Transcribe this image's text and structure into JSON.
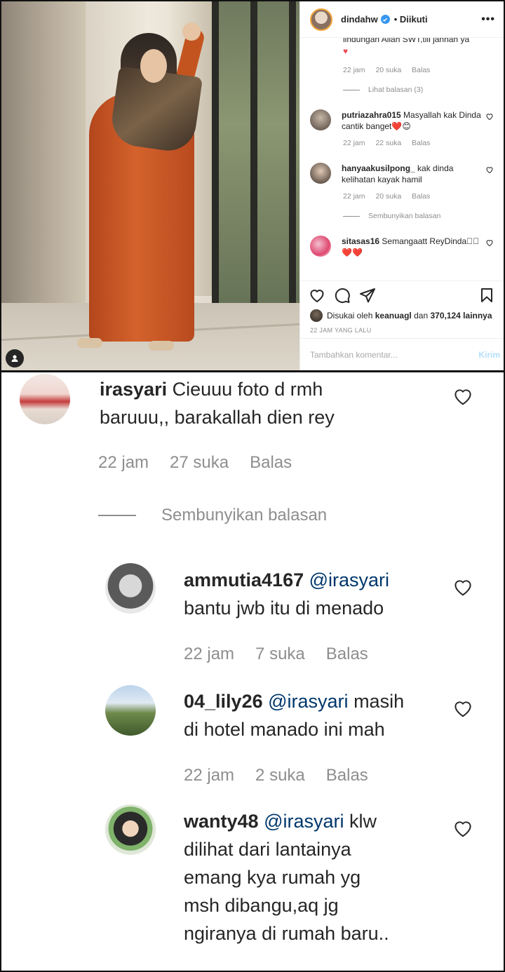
{
  "post": {
    "username": "dindahw",
    "follow_status": "Diikuti",
    "more_label": "•••",
    "cut_comment_text": "lindungan Allah SWT,till jannah ya",
    "cut_comment_meta": {
      "time": "22 jam",
      "likes": "20 suka",
      "reply": "Balas"
    },
    "view_replies": "Lihat balasan (3)",
    "comments": [
      {
        "username": "putriazahra015",
        "text": "Masyallah kak Dinda cantik banget❤️😊",
        "time": "22 jam",
        "likes": "22 suka",
        "reply": "Balas"
      },
      {
        "username": "hanyaakusilpong_",
        "text": "kak dinda kelihatan kayak hamil",
        "time": "22 jam",
        "likes": "20 suka",
        "reply": "Balas"
      },
      {
        "username": "sitasas16",
        "text": "Semangaatt ReyDinda🏻🏻❤️❤️"
      }
    ],
    "hide_replies": "Sembunyikan balasan",
    "liked_by_prefix": "Disukai oleh",
    "liked_by_user": "keanuagl",
    "liked_by_middle": "dan",
    "liked_by_count": "370,124 lainnya",
    "timestamp": "22 JAM YANG LALU",
    "add_comment_placeholder": "Tambahkan komentar...",
    "post_button": "Kirim"
  },
  "zoom": {
    "main_comment": {
      "username": "irasyari",
      "text_line1": "Cieuuu foto d rmh",
      "text_line2": "baruuu,, barakallah dien rey",
      "time": "22 jam",
      "likes": "27 suka",
      "reply": "Balas"
    },
    "hide_replies": "Sembunyikan balasan",
    "replies": [
      {
        "username": "ammutia4167",
        "mention": "@irasyari",
        "line1_rest": "",
        "lines": [
          "bantu jwb itu di menado"
        ],
        "time": "22 jam",
        "likes": "7 suka",
        "reply": "Balas"
      },
      {
        "username": "04_lily26",
        "mention": "@irasyari",
        "line1_rest": "masih",
        "lines": [
          "di hotel manado ini mah"
        ],
        "time": "22 jam",
        "likes": "2 suka",
        "reply": "Balas"
      },
      {
        "username": "wanty48",
        "mention": "@irasyari",
        "line1_rest": "klw",
        "lines": [
          "dilihat dari lantainya",
          "emang kya rumah yg",
          "msh dibangu,aq jg",
          "ngiranya di rumah baru.."
        ]
      }
    ]
  },
  "colors": {
    "link": "#00376b",
    "meta": "#8e8e8e",
    "verified": "#3897f0",
    "heart": "#ed4956"
  }
}
